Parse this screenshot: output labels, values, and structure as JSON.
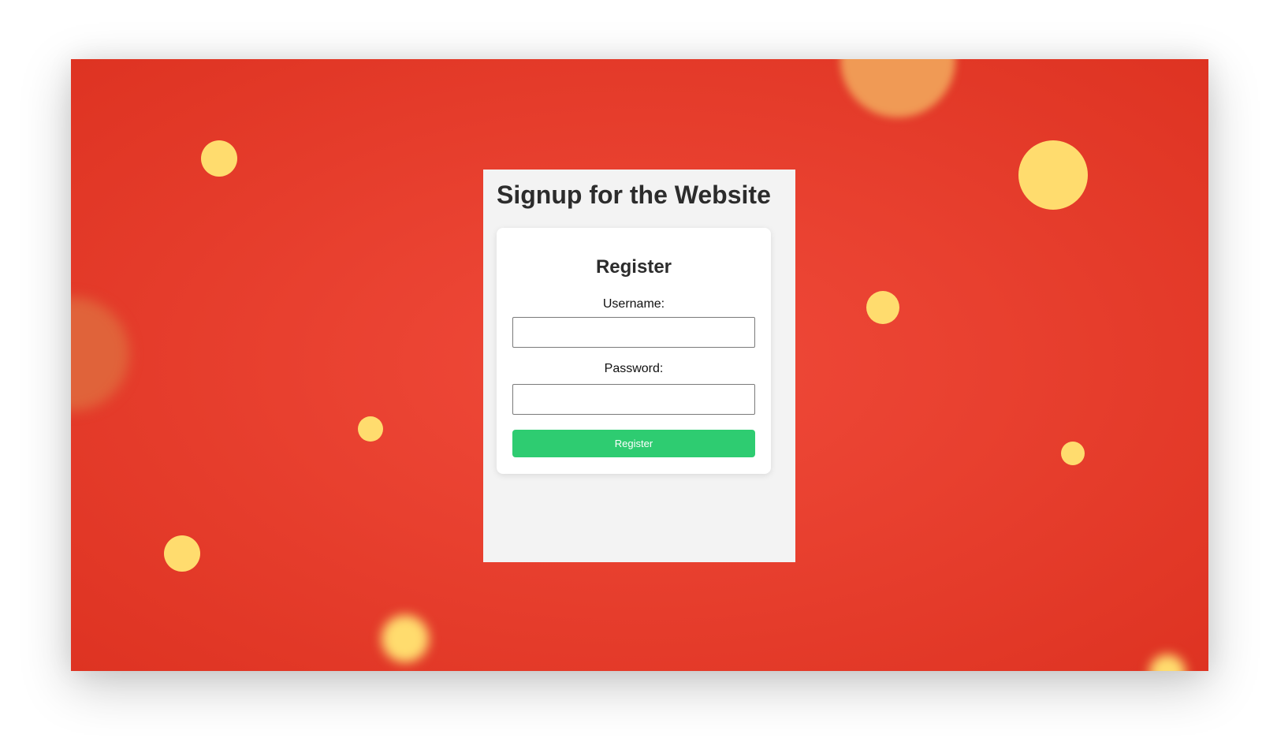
{
  "page": {
    "title": "Signup for the Website"
  },
  "form": {
    "heading": "Register",
    "username_label": "Username:",
    "username_value": "",
    "password_label": "Password:",
    "password_value": "",
    "submit_label": "Register"
  },
  "colors": {
    "background": "#e8402f",
    "accent_dots": "#ffdc6e",
    "button": "#2ecc71",
    "panel": "#f3f3f3"
  }
}
